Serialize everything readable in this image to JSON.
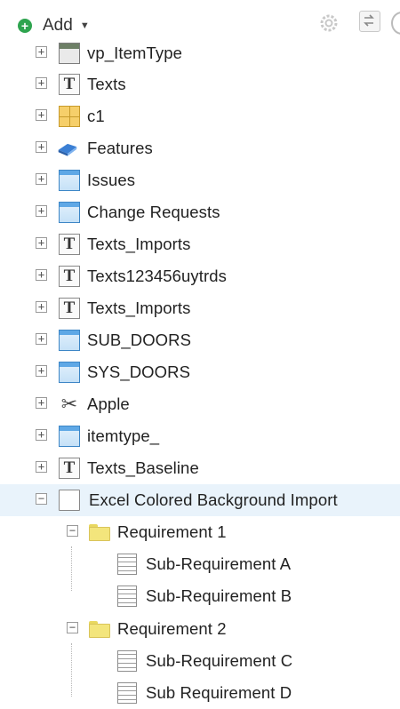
{
  "toolbar": {
    "add_label": "Add",
    "add_caret": "▼",
    "icons": [
      "add-icon",
      "settings-icon",
      "swap-icon",
      "more-icon"
    ]
  },
  "tree": {
    "expand_glyph": "+",
    "collapse_glyph": "−",
    "items": [
      {
        "label": "vp_ItemType",
        "icon": "window-dark-icon",
        "expanded": false
      },
      {
        "label": "Texts",
        "icon": "text-type-icon",
        "expanded": false
      },
      {
        "label": "c1",
        "icon": "grid-icon",
        "expanded": false
      },
      {
        "label": "Features",
        "icon": "feature-book-icon",
        "expanded": false
      },
      {
        "label": "Issues",
        "icon": "window-icon",
        "expanded": false
      },
      {
        "label": "Change Requests",
        "icon": "window-icon",
        "expanded": false
      },
      {
        "label": "Texts_Imports",
        "icon": "text-type-icon",
        "expanded": false
      },
      {
        "label": "Texts123456uytrds",
        "icon": "text-type-icon",
        "expanded": false
      },
      {
        "label": "Texts_Imports",
        "icon": "text-type-icon",
        "expanded": false
      },
      {
        "label": "SUB_DOORS",
        "icon": "window-icon",
        "expanded": false
      },
      {
        "label": "SYS_DOORS",
        "icon": "window-icon",
        "expanded": false
      },
      {
        "label": "Apple",
        "icon": "scissors-icon",
        "expanded": false
      },
      {
        "label": "itemtype_",
        "icon": "window-icon",
        "expanded": false
      },
      {
        "label": "Texts_Baseline",
        "icon": "text-type-icon",
        "expanded": false
      },
      {
        "label": "Excel Colored Background Import",
        "icon": "document-icon",
        "expanded": true,
        "selected": true
      },
      {
        "label": "Requirement 1",
        "icon": "folder-icon",
        "expanded": true
      },
      {
        "label": "Sub-Requirement A",
        "icon": "sheet-icon"
      },
      {
        "label": "Sub-Requirement B",
        "icon": "sheet-icon"
      },
      {
        "label": "Requirement 2",
        "icon": "folder-icon",
        "expanded": true
      },
      {
        "label": "Sub-Requirement C",
        "icon": "sheet-icon"
      },
      {
        "label": "Sub Requirement D",
        "icon": "sheet-icon"
      }
    ]
  }
}
